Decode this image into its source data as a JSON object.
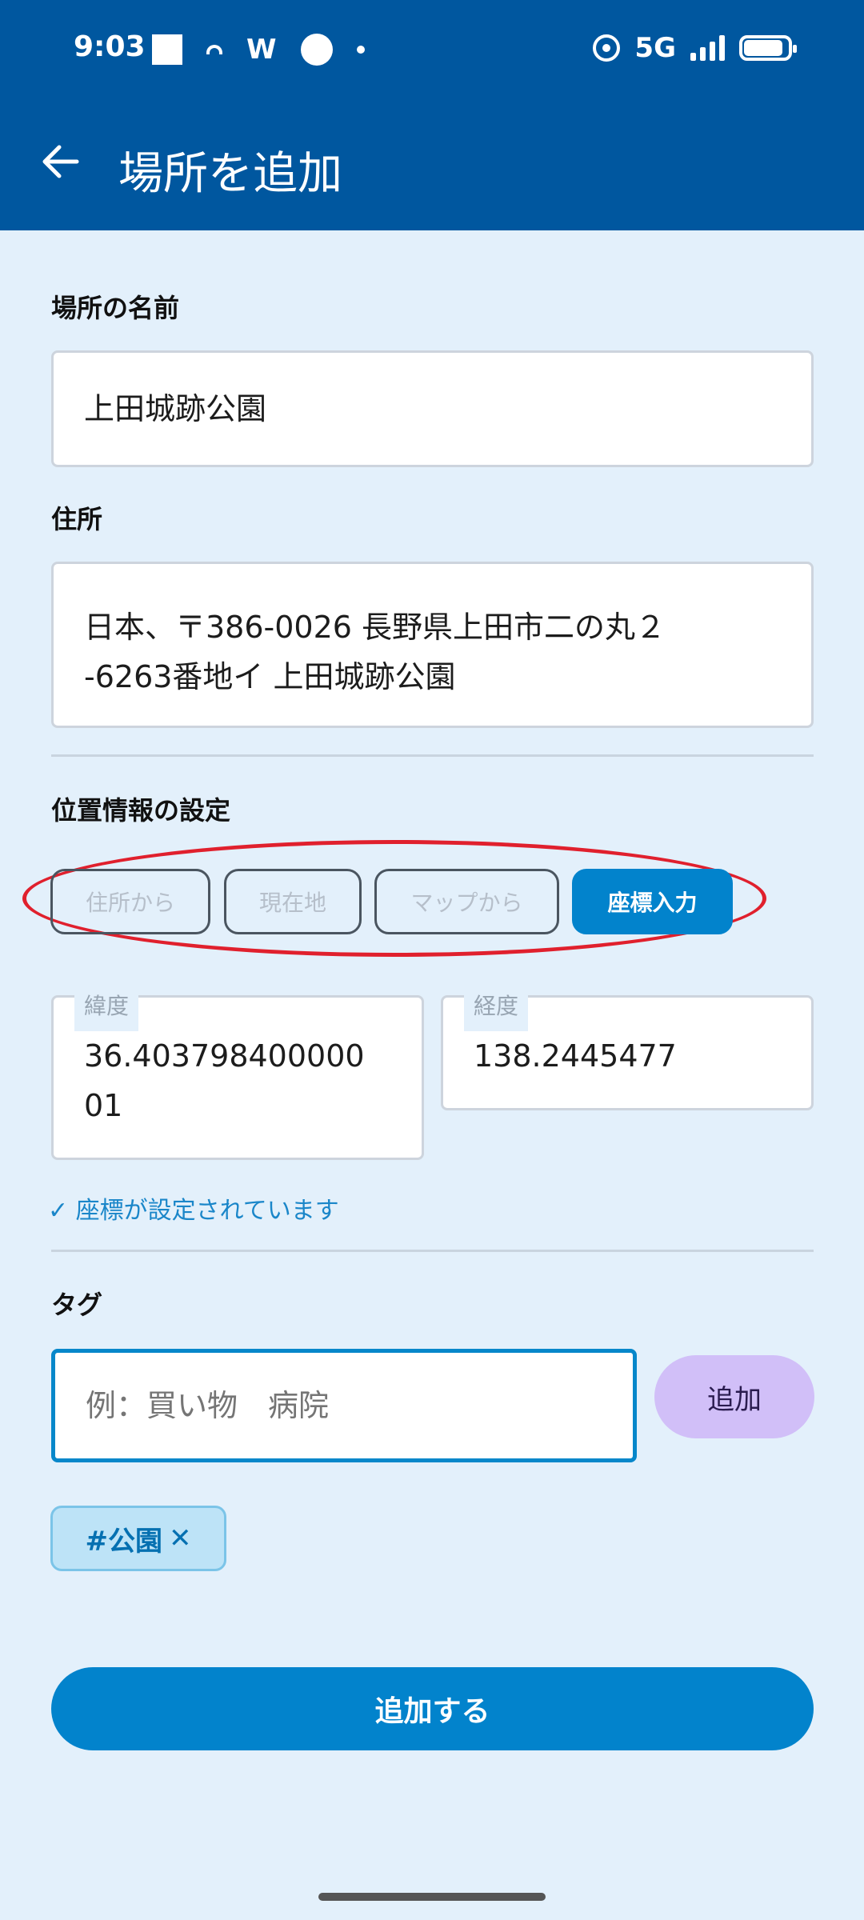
{
  "status_bar": {
    "time": "9:03",
    "left_icons": [
      "notification-square-icon",
      "cast-icon",
      "w-app-icon",
      "circle-app-icon",
      "dot-icon"
    ],
    "w_glyph": "W",
    "network": "5G",
    "right_icons": [
      "hotspot-icon",
      "signal-icon",
      "battery-icon"
    ]
  },
  "app_bar": {
    "title": "場所を追加",
    "back_icon": "arrow-left-icon"
  },
  "form": {
    "name_label": "場所の名前",
    "name_value": "上田城跡公園",
    "address_label": "住所",
    "address_line1": "日本、〒386-0026 長野県上田市二の丸２",
    "address_line2": "-6263番地イ 上田城跡公園",
    "location_label": "位置情報の設定",
    "location_modes": [
      {
        "label": "住所から",
        "active": false
      },
      {
        "label": "現在地",
        "active": false
      },
      {
        "label": "マップから",
        "active": false
      },
      {
        "label": "座標入力",
        "active": true
      }
    ],
    "latitude_label": "緯度",
    "latitude_line1": "36.403798400000",
    "latitude_line2": "01",
    "longitude_label": "経度",
    "longitude_value": "138.2445477",
    "coord_status": "✓ 座標が設定されています",
    "tag_label": "タグ",
    "tag_placeholder": "例：買い物　病院",
    "tag_add_label": "追加",
    "tags": [
      {
        "text": "#公園",
        "remove_glyph": "✕"
      }
    ],
    "submit_label": "追加する"
  },
  "colors": {
    "app_bar": "#00579f",
    "background": "#e3f0fb",
    "primary": "#0283cc",
    "highlight_ring": "#e0202d",
    "tag_add_bg": "#d1bff8"
  }
}
